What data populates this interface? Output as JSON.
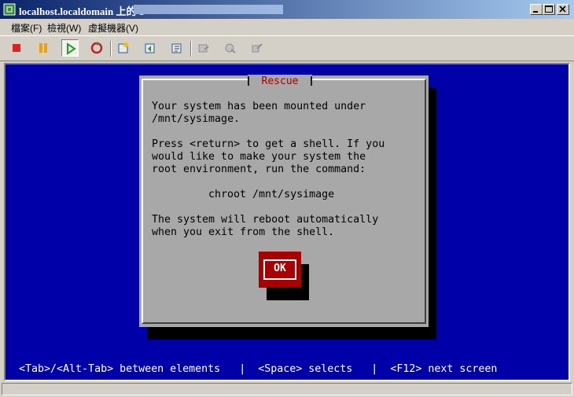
{
  "window": {
    "title": "localhost.localdomain 上的 1",
    "controls": [
      "minimize",
      "maximize",
      "close"
    ]
  },
  "menu": [
    "檔案(F)",
    "檢視(W)",
    "虛擬機器(V)"
  ],
  "toolbar": {
    "buttons": [
      {
        "name": "stop",
        "icon": "stop-square-icon",
        "color": "#e02020"
      },
      {
        "name": "pause",
        "icon": "pause-icon",
        "color": "#f0a000"
      },
      {
        "name": "play",
        "icon": "play-icon",
        "color": "#20a020",
        "pressed": true
      },
      {
        "name": "reset",
        "icon": "reset-icon",
        "color": "#c02020"
      },
      {
        "name": "snapshot",
        "icon": "snapshot-icon"
      },
      {
        "name": "revert-snapshot",
        "icon": "revert-snapshot-icon"
      },
      {
        "name": "manage-snapshots",
        "icon": "manage-snapshots-icon"
      },
      {
        "name": "disabled-1",
        "icon": "devices-icon",
        "disabled": true
      },
      {
        "name": "disabled-2",
        "icon": "settings-icon",
        "disabled": true
      },
      {
        "name": "disabled-3",
        "icon": "network-icon",
        "disabled": true
      }
    ]
  },
  "console": {
    "bg_color": "#0000a8",
    "dialog": {
      "title": "Rescue",
      "lines": [
        "Your system has been mounted under",
        "/mnt/sysimage.",
        "",
        "Press <return> to get a shell. If you",
        "would like to make your system the",
        "root environment, run the command:",
        "",
        "chroot /mnt/sysimage",
        "",
        "The system will reboot automatically",
        "when you exit from the shell."
      ],
      "ok_label": "OK"
    },
    "status_line": "<Tab>/<Alt-Tab> between elements   |  <Space> selects   |  <F12> next screen"
  }
}
